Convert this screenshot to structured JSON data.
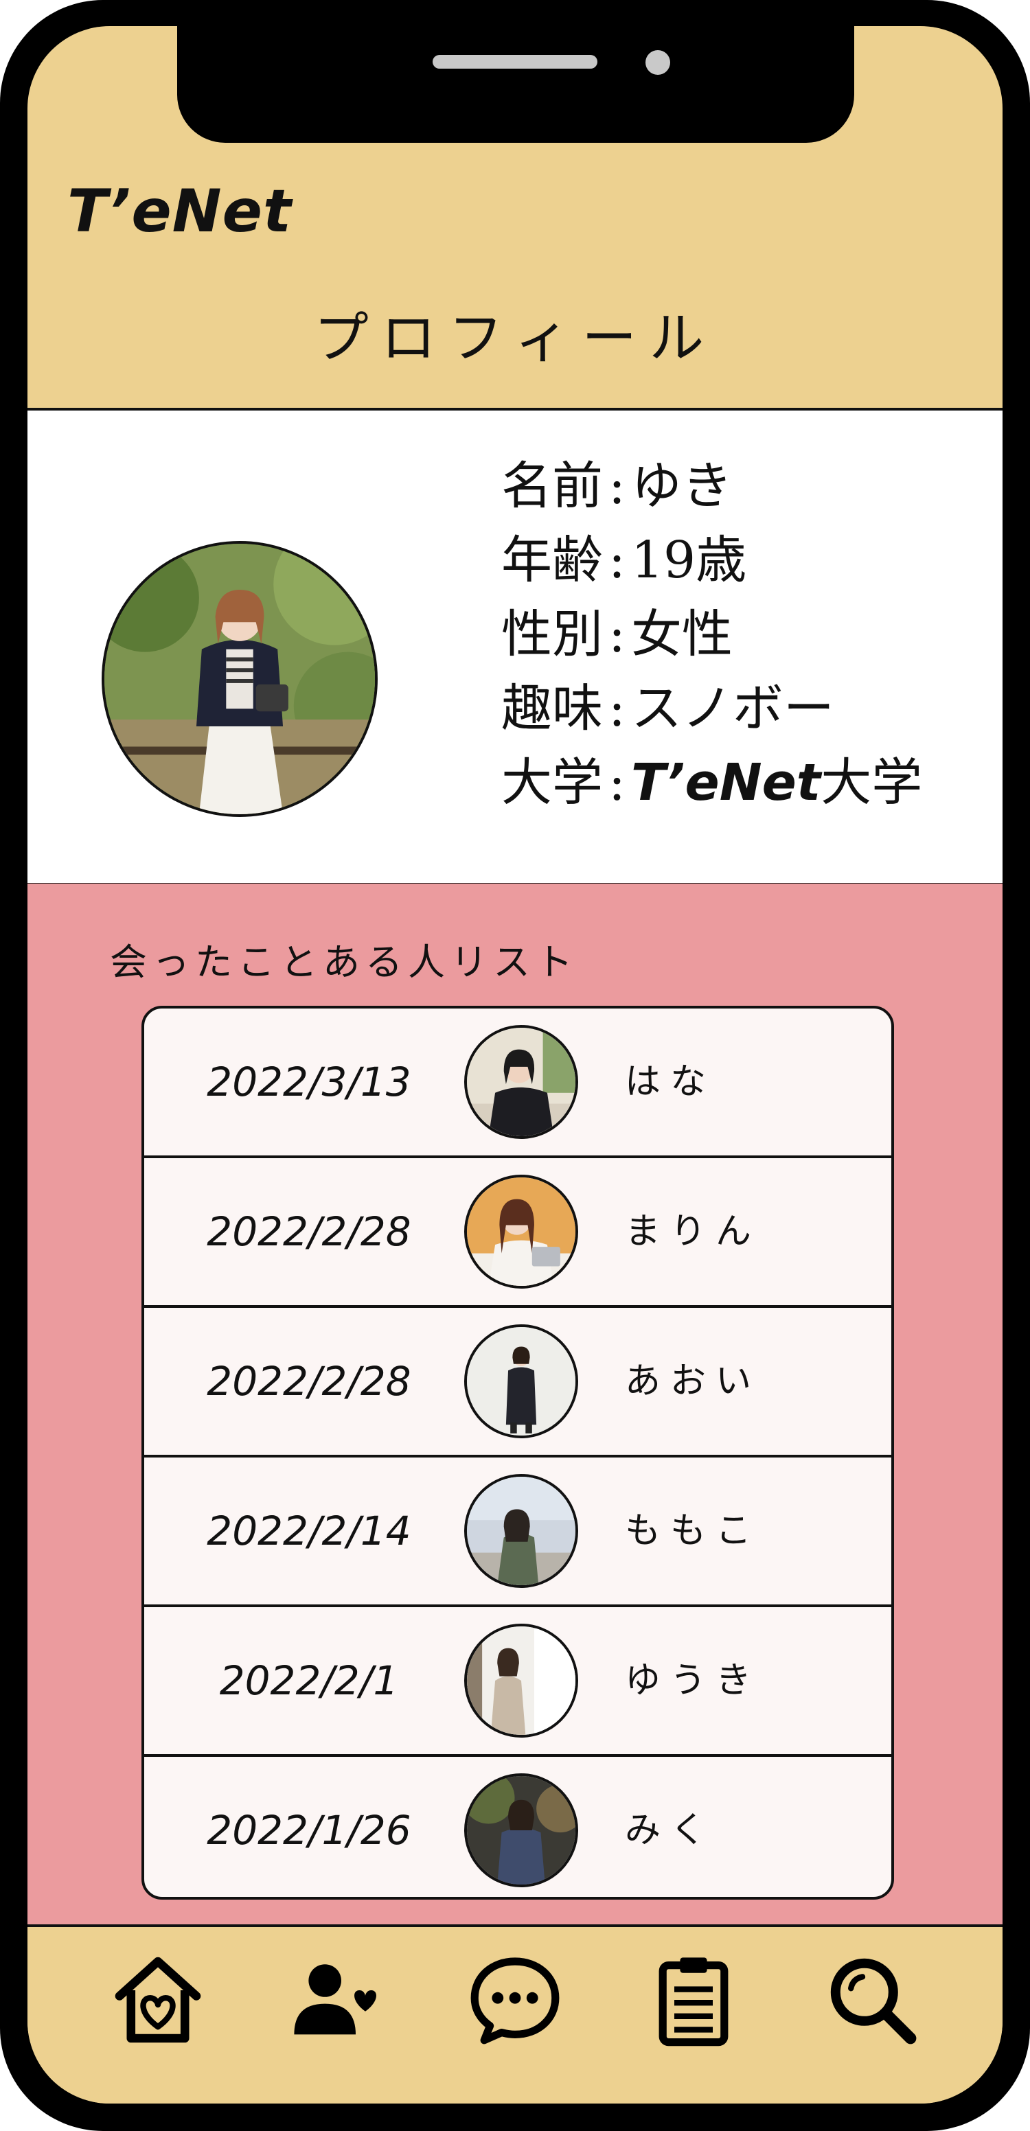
{
  "app": {
    "brand": "T’eNet",
    "page_title": "プロフィール"
  },
  "profile": {
    "rows": [
      {
        "label": "名前",
        "sep": ":",
        "value": "ゆき"
      },
      {
        "label": "年齢",
        "sep": ":",
        "value": "19歳"
      },
      {
        "label": "性別",
        "sep": ":",
        "value": "女性"
      },
      {
        "label": "趣味",
        "sep": ":",
        "value": "スノボー"
      },
      {
        "label": "大学",
        "sep": ":",
        "value_brand": "T’eNet",
        "value": "大学"
      }
    ]
  },
  "met_list": {
    "title": "会ったことある人リスト",
    "items": [
      {
        "date": "2022/3/13",
        "name": "はな"
      },
      {
        "date": "2022/2/28",
        "name": "まりん"
      },
      {
        "date": "2022/2/28",
        "name": "あおい"
      },
      {
        "date": "2022/2/14",
        "name": "ももこ"
      },
      {
        "date": "2022/2/1",
        "name": "ゆうき"
      },
      {
        "date": "2022/1/26",
        "name": "みく"
      }
    ]
  },
  "nav": {
    "items": [
      {
        "icon": "home-heart-icon"
      },
      {
        "icon": "friends-heart-icon"
      },
      {
        "icon": "chat-bubble-icon"
      },
      {
        "icon": "clipboard-icon"
      },
      {
        "icon": "search-icon"
      }
    ]
  },
  "colors": {
    "header_bg": "#edd190",
    "list_section_bg": "#eb9b9e",
    "list_card_bg": "#fcf6f5",
    "frame": "#000000"
  }
}
